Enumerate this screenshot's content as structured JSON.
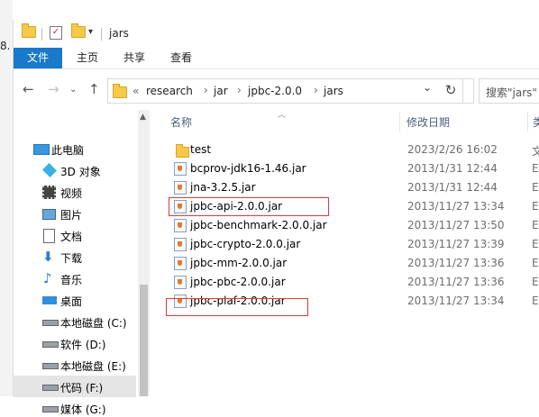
{
  "window": {
    "title": "jars"
  },
  "stray_text": "8.",
  "ribbon": {
    "tabs": [
      "文件",
      "主页",
      "共享",
      "查看"
    ]
  },
  "breadcrumb": {
    "overflow": "«",
    "parts": [
      "research",
      "jar",
      "jpbc-2.0.0",
      "jars"
    ]
  },
  "search": {
    "placeholder": "搜索\"jars\""
  },
  "nav_pane": {
    "items": [
      {
        "label": "此电脑",
        "icon": "computer-icon"
      },
      {
        "label": "3D 对象",
        "icon": "3d-objects-icon"
      },
      {
        "label": "视频",
        "icon": "video-icon"
      },
      {
        "label": "图片",
        "icon": "pictures-icon"
      },
      {
        "label": "文档",
        "icon": "documents-icon"
      },
      {
        "label": "下载",
        "icon": "download-icon"
      },
      {
        "label": "音乐",
        "icon": "music-icon"
      },
      {
        "label": "桌面",
        "icon": "desktop-icon"
      },
      {
        "label": "本地磁盘 (C:)",
        "icon": "drive-icon"
      },
      {
        "label": "软件 (D:)",
        "icon": "drive-icon"
      },
      {
        "label": "本地磁盘 (E:)",
        "icon": "drive-icon"
      },
      {
        "label": "代码 (F:)",
        "icon": "drive-icon",
        "selected": true
      },
      {
        "label": "媒体 (G:)",
        "icon": "drive-icon"
      }
    ]
  },
  "file_list": {
    "columns": {
      "name": "名称",
      "date": "修改日期",
      "type": "类"
    },
    "rows": [
      {
        "name": "test",
        "date": "2023/2/26 16:02",
        "type": "文",
        "icon": "folder-icon"
      },
      {
        "name": "bcprov-jdk16-1.46.jar",
        "date": "2013/1/31 12:44",
        "type": "E",
        "icon": "jar-file-icon"
      },
      {
        "name": "jna-3.2.5.jar",
        "date": "2013/1/31 12:44",
        "type": "E",
        "icon": "jar-file-icon"
      },
      {
        "name": "jpbc-api-2.0.0.jar",
        "date": "2013/11/27 13:34",
        "type": "E",
        "icon": "jar-file-icon",
        "highlighted": true
      },
      {
        "name": "jpbc-benchmark-2.0.0.jar",
        "date": "2013/11/27 13:50",
        "type": "E",
        "icon": "jar-file-icon"
      },
      {
        "name": "jpbc-crypto-2.0.0.jar",
        "date": "2013/11/27 13:39",
        "type": "E",
        "icon": "jar-file-icon"
      },
      {
        "name": "jpbc-mm-2.0.0.jar",
        "date": "2013/11/27 13:36",
        "type": "E",
        "icon": "jar-file-icon"
      },
      {
        "name": "jpbc-pbc-2.0.0.jar",
        "date": "2013/11/27 13:36",
        "type": "E",
        "icon": "jar-file-icon"
      },
      {
        "name": "jpbc-plaf-2.0.0.jar",
        "date": "2013/11/27 13:34",
        "type": "E",
        "icon": "jar-file-icon",
        "highlighted": true
      }
    ]
  },
  "colors": {
    "file_tab": "#1979ca",
    "highlight_box": "#e03a3a",
    "folder": "#f7c948"
  }
}
